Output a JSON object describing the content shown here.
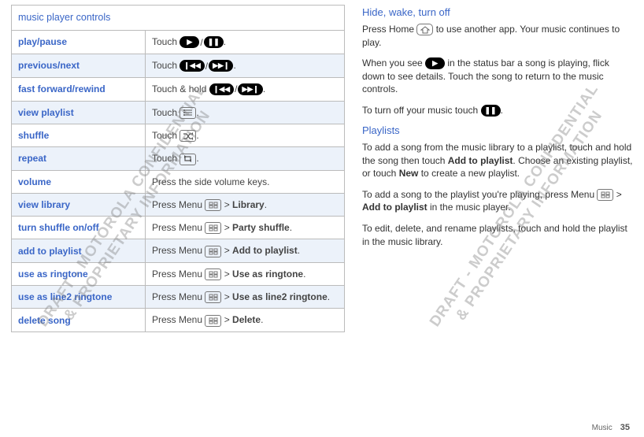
{
  "table": {
    "header": "music player controls",
    "rows": [
      {
        "func": "play/pause",
        "act_prefix": "Touch ",
        "icons": "play-pause",
        "act_suffix": "."
      },
      {
        "func": "previous/next",
        "act_prefix": "Touch ",
        "icons": "prev-next",
        "act_suffix": "."
      },
      {
        "func": "fast forward/rewind",
        "act_prefix": "Touch & hold ",
        "icons": "prev-next",
        "act_suffix": "."
      },
      {
        "func": "view playlist",
        "act_prefix": "Touch ",
        "icons": "list",
        "act_suffix": "."
      },
      {
        "func": "shuffle",
        "act_prefix": "Touch ",
        "icons": "shuffle",
        "act_suffix": "."
      },
      {
        "func": "repeat",
        "act_prefix": "Touch ",
        "icons": "repeat",
        "act_suffix": "."
      },
      {
        "func": "volume",
        "act_prefix": "Press the side volume keys.",
        "icons": "",
        "act_suffix": ""
      },
      {
        "func": "view library",
        "act_prefix": "Press Menu ",
        "icons": "menu",
        "act_suffix": " > ",
        "bold": "Library",
        "tail": "."
      },
      {
        "func": "turn shuffle on/off",
        "act_prefix": "Press Menu ",
        "icons": "menu",
        "act_suffix": " > ",
        "bold": "Party shuffle",
        "tail": "."
      },
      {
        "func": "add to playlist",
        "act_prefix": "Press Menu ",
        "icons": "menu",
        "act_suffix": " > ",
        "bold": "Add to playlist",
        "tail": "."
      },
      {
        "func": "use as ringtone",
        "act_prefix": "Press Menu ",
        "icons": "menu",
        "act_suffix": " > ",
        "bold": "Use as ringtone",
        "tail": "."
      },
      {
        "func": "use as line2 ringtone",
        "act_prefix": "Press Menu ",
        "icons": "menu",
        "act_suffix": " > ",
        "bold": "Use as line2 ringtone",
        "tail": "."
      },
      {
        "func": "delete song",
        "act_prefix": "Press Menu ",
        "icons": "menu",
        "act_suffix": " > ",
        "bold": "Delete",
        "tail": "."
      }
    ]
  },
  "right": {
    "h1": "Hide, wake, turn off",
    "p1a": "Press Home ",
    "p1b": " to use another app. Your music continues to play.",
    "p2a": "When you see ",
    "p2b": " in the status bar a song is playing, flick down to see details. Touch the song to return to the music controls.",
    "p3a": "To turn off your music touch ",
    "p3b": ".",
    "h2": "Playlists",
    "p4a": "To add a song from the music library to a playlist, touch and hold the song then touch ",
    "p4bold1": "Add to playlist",
    "p4b": ". Choose an existing playlist, or touch ",
    "p4bold2": "New",
    "p4c": " to create a new playlist.",
    "p5a": "To add a song to the playlist you're playing, press Menu ",
    "p5b": " > ",
    "p5bold": "Add to playlist",
    "p5c": " in the music player.",
    "p6": "To edit, delete, and rename playlists, touch and hold the playlist in the music library."
  },
  "watermark_line1": "DRAFT - MOTOROLA CONFIDENTIAL",
  "watermark_line2": "& PROPRIETARY INFORMATION",
  "footer_section": "Music",
  "footer_page": "35"
}
